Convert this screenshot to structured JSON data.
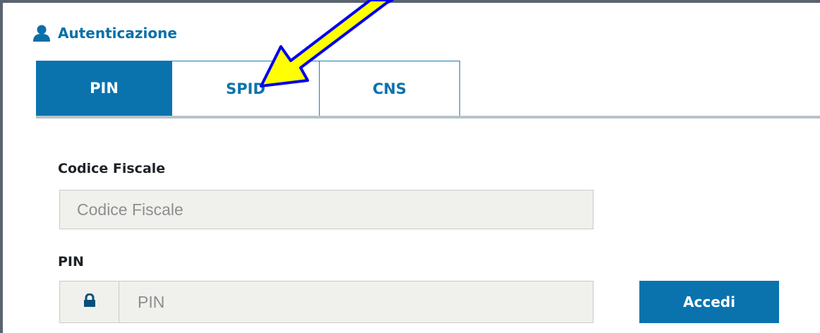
{
  "header": {
    "title": "Autenticazione",
    "icon": "user-icon",
    "color": "#0a6fa8"
  },
  "tabs": [
    {
      "label": "PIN",
      "active": true
    },
    {
      "label": "SPID",
      "active": false
    },
    {
      "label": "CNS",
      "active": false
    }
  ],
  "form": {
    "codice_fiscale": {
      "label": "Codice Fiscale",
      "placeholder": "Codice Fiscale",
      "value": ""
    },
    "pin": {
      "label": "PIN",
      "placeholder": "PIN",
      "value": "",
      "icon": "lock-icon"
    },
    "submit_label": "Accedi"
  },
  "annotation": {
    "icon": "yellow-arrow-icon",
    "fill": "#ffff00",
    "stroke": "#0000ee"
  },
  "colors": {
    "accent": "#0a73ae",
    "frame": "#5a6370",
    "input_bg": "#f0f0ec"
  }
}
